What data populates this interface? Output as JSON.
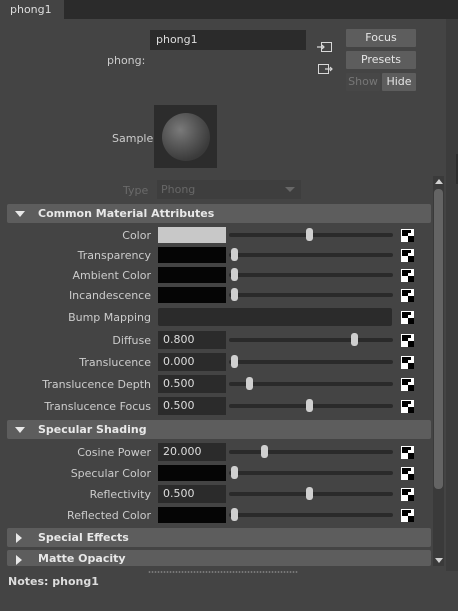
{
  "tab": {
    "label": "phong1"
  },
  "header": {
    "name_label": "phong:",
    "name_value": "phong1",
    "focus_label": "Focus",
    "presets_label": "Presets",
    "show_label": "Show",
    "hide_label": "Hide",
    "sample_label": "Sample",
    "type_label": "Type",
    "type_value": "Phong"
  },
  "sections": {
    "common": "Common Material Attributes",
    "specular": "Specular Shading",
    "special": "Special Effects",
    "matte": "Matte Opacity"
  },
  "common_attributes": [
    {
      "label": "Color",
      "kind": "color",
      "swatch": "#c8c8c8",
      "slider": 0.5
    },
    {
      "label": "Transparency",
      "kind": "color",
      "swatch": "#050505",
      "slider": 0.0
    },
    {
      "label": "Ambient Color",
      "kind": "color",
      "swatch": "#050505",
      "slider": 0.0
    },
    {
      "label": "Incandescence",
      "kind": "color",
      "swatch": "#050505",
      "slider": 0.0
    },
    {
      "label": "Bump Mapping",
      "kind": "field"
    },
    {
      "label": "Diffuse",
      "kind": "number",
      "value": "0.800",
      "slider": 0.8
    },
    {
      "label": "Translucence",
      "kind": "number",
      "value": "0.000",
      "slider": 0.0
    },
    {
      "label": "Translucence Depth",
      "kind": "number",
      "value": "0.500",
      "slider": 0.1
    },
    {
      "label": "Translucence Focus",
      "kind": "number",
      "value": "0.500",
      "slider": 0.5
    }
  ],
  "specular_attributes": [
    {
      "label": "Cosine Power",
      "kind": "number",
      "value": "20.000",
      "slider": 0.2
    },
    {
      "label": "Specular Color",
      "kind": "color",
      "swatch": "#050505",
      "slider": 0.0
    },
    {
      "label": "Reflectivity",
      "kind": "number",
      "value": "0.500",
      "slider": 0.5
    },
    {
      "label": "Reflected Color",
      "kind": "color",
      "swatch": "#050505",
      "slider": 0.0
    }
  ],
  "notes": {
    "label": "Notes:",
    "value": "phong1"
  },
  "colors": {
    "panel": "#444444",
    "section_header": "#5d5d5d",
    "field": "#2b2b2b",
    "button": "#5d5d5d"
  }
}
